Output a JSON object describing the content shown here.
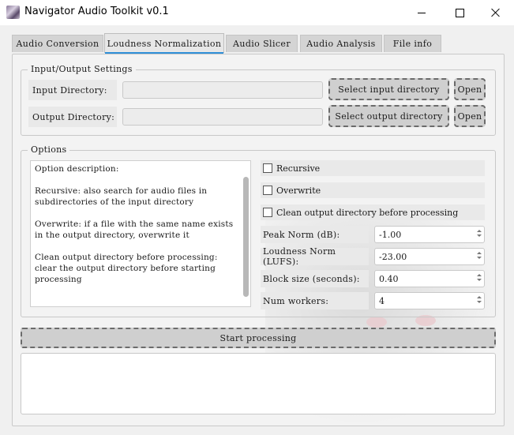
{
  "window": {
    "title": "Navigator Audio Toolkit v0.1"
  },
  "tabs": [
    {
      "label": "Audio Conversion"
    },
    {
      "label": "Loudness Normalization"
    },
    {
      "label": "Audio Slicer"
    },
    {
      "label": "Audio Analysis"
    },
    {
      "label": "File info"
    }
  ],
  "io": {
    "group_title": "Input/Output Settings",
    "input_label": "Input  Directory:",
    "input_value": "",
    "select_input_label": "Select input  directory",
    "open_input_label": "Open",
    "output_label": "Output Directory:",
    "output_value": "",
    "select_output_label": "Select output directory",
    "open_output_label": "Open"
  },
  "options": {
    "group_title": "Options",
    "description": "Option description:\n\nRecursive: also search for audio files in subdirectories of the input directory\n\nOverwrite: if a file with the same name exists in the output directory, overwrite it\n\nClean output directory before processing: clear the output directory before starting processing",
    "recursive_label": "Recursive",
    "recursive_checked": false,
    "overwrite_label": "Overwrite",
    "overwrite_checked": false,
    "clean_label": "Clean output directory before processing",
    "clean_checked": false,
    "peak_label": "Peak Norm (dB):",
    "peak_value": "-1.00",
    "loudness_label": "Loudness Norm (LUFS):",
    "loudness_value": "-23.00",
    "block_label": "Block size (seconds):",
    "block_value": "0.40",
    "workers_label": "Num workers:",
    "workers_value": "4"
  },
  "start_label": "Start processing",
  "accent_color": "#2f8fd8"
}
